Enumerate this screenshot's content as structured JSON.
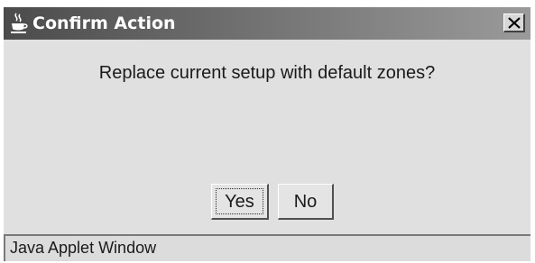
{
  "window": {
    "title": "Confirm Action",
    "title_icon": "java-coffee-cup-icon",
    "close_icon": "close-icon"
  },
  "dialog": {
    "message": "Replace current setup with default zones?",
    "buttons": {
      "yes_label": "Yes",
      "no_label": "No",
      "focused": "Yes"
    }
  },
  "statusbar": {
    "text": "Java Applet Window"
  },
  "colors": {
    "titlebar_start": "#4b4b4b",
    "titlebar_end": "#9a9a9a",
    "dialog_background": "#e0e0e0"
  }
}
